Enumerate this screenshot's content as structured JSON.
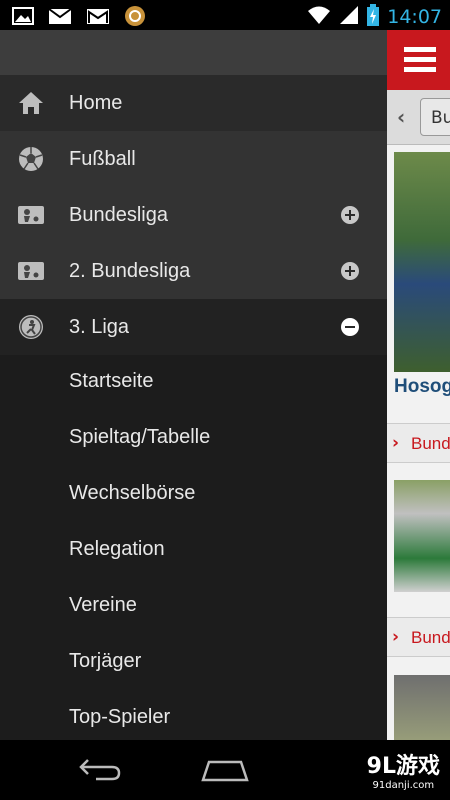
{
  "status_bar": {
    "time": "14:07",
    "left_icons": [
      "image-icon",
      "mail-icon",
      "gmail-icon",
      "circle-app-icon"
    ],
    "right_icons": [
      "wifi-icon",
      "signal-icon",
      "battery-charging-icon"
    ]
  },
  "drawer": {
    "items": [
      {
        "label": "Home",
        "icon": "home-icon"
      },
      {
        "label": "Fußball",
        "icon": "soccer-ball-icon"
      },
      {
        "label": "Bundesliga",
        "icon": "bundesliga-logo-icon",
        "toggle": "plus"
      },
      {
        "label": "2. Bundesliga",
        "icon": "bundesliga-logo-icon",
        "toggle": "plus"
      },
      {
        "label": "3. Liga",
        "icon": "liga3-logo-icon",
        "toggle": "minus"
      }
    ],
    "subitems": [
      {
        "label": "Startseite"
      },
      {
        "label": "Spieltag/Tabelle"
      },
      {
        "label": "Wechselbörse"
      },
      {
        "label": "Relegation"
      },
      {
        "label": "Vereine"
      },
      {
        "label": "Torjäger"
      },
      {
        "label": "Top-Spieler"
      }
    ]
  },
  "content": {
    "tab_label": "Bu",
    "article_title": "Hosog",
    "links": [
      {
        "label": "Bund"
      },
      {
        "label": "Bund"
      }
    ]
  },
  "watermark": {
    "main": "9L游戏",
    "sub": "91danji.com"
  },
  "colors": {
    "accent_red": "#c8181e",
    "status_time": "#33b5e5",
    "drawer_bg": "#1c1c1c"
  }
}
